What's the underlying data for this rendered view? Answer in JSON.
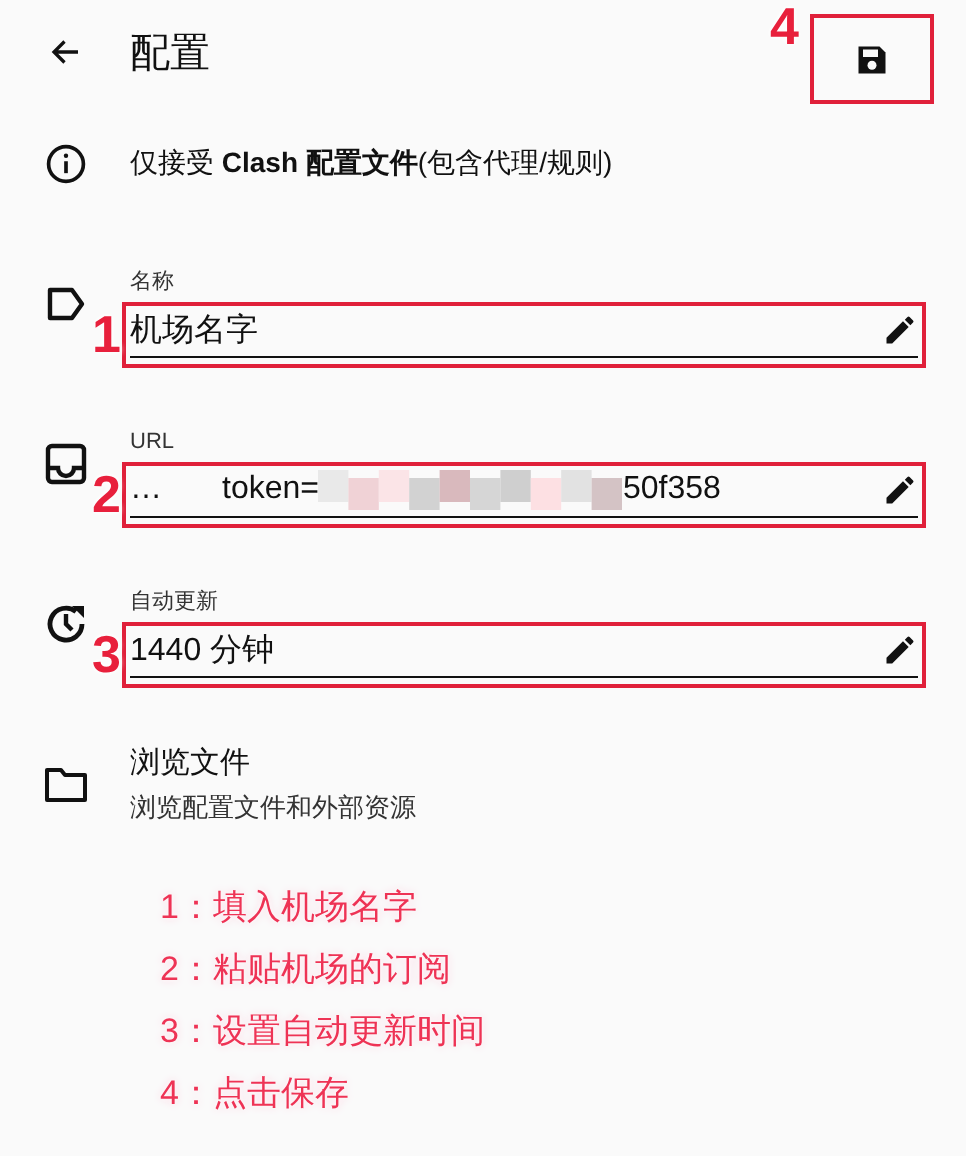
{
  "app_bar": {
    "title": "配置",
    "annotation": "4"
  },
  "notice": {
    "text": "仅接受 **Clash 配置文件**(包含代理/规则)"
  },
  "fields": [
    {
      "kind": "name",
      "label": "名称",
      "value": "机场名字",
      "annotation": "1"
    },
    {
      "kind": "url",
      "label": "URL",
      "value_start": "…",
      "value_mid": "token=",
      "value_end": "50f358",
      "annotation": "2"
    },
    {
      "kind": "interval",
      "label": "自动更新",
      "value": "1440 分钟",
      "annotation": "3"
    }
  ],
  "browse": {
    "title": "浏览文件",
    "subtitle": "浏览配置文件和外部资源"
  },
  "legend": [
    "1：填入机场名字",
    "2：粘贴机场的订阅",
    "3：设置自动更新时间",
    "4：点击保存"
  ]
}
